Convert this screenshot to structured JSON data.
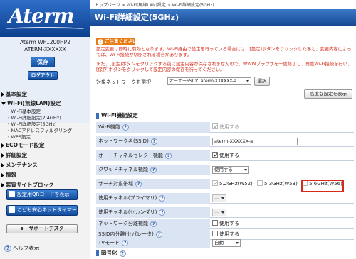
{
  "sidebar": {
    "logo": "Aterm",
    "model_name": "Aterm  WF1200HP2",
    "model_id": "ATERM-XXXXXX",
    "save_label": "保存",
    "logout_label": "ログアウト",
    "nav": {
      "basic": "基本設定",
      "wifi": "Wi-Fi(無線LAN)設定",
      "wifi_sub": [
        "Wi-Fi基本設定",
        "Wi-Fi詳細設定(2.4GHz)",
        "Wi-Fi詳細設定(5GHz)",
        "MACアドレスフィルタリング",
        "WPS設定"
      ],
      "eco": "ECOモード設定",
      "detail": "詳細設定",
      "maintenance": "メンテナンス",
      "info": "情報",
      "block": "悪質サイトブロック"
    },
    "qr_button": "設定用QRコードを表示",
    "kids_button": "こども安心ネットタイマー",
    "support_button": "サポートデスク",
    "help_link": "ヘルプ表示"
  },
  "main": {
    "breadcrumb": "トップページ > Wi-Fi(無線LAN)設定 > Wi-Fi詳細設定(5GHz)",
    "title": "Wi-Fi詳細設定(5GHz)",
    "notice_badge": "ご注意ください",
    "notice1": "設定変更は即時に有効となります。Wi-Fi経由で設定を行っている場合には、[設定]ボタンをクリックしたあと、変更内容によっては、Wi-Fi接続が切断される場合があります。",
    "notice2": "また、[設定]ボタンをクリックする前に設定内容が保存されませんので、WWWブラウザを一度終了し、再度Wi-Fi接続を行い、[保存]ボタンをクリックして設定内容の保存を行ってください。",
    "target_network_label": "対象ネットワークを選択",
    "target_network_value": "オーナーSSID：aterm-XXXXXX-a",
    "select_button": "選択",
    "advanced_button": "高度な設定を表示",
    "section1_title": "Wi-Fi機能設定",
    "section2_title": "暗号化",
    "rows": {
      "wifi_func": {
        "label": "Wi-Fi機能",
        "value": "使用する"
      },
      "ssid": {
        "label": "ネットワーク名(SSID)",
        "value": "aterm-XXXXXX-a"
      },
      "auto_channel": {
        "label": "オートチャネルセレクト機能",
        "value": "使用する"
      },
      "quad": {
        "label": "クワッドチャネル機能",
        "value": "使用する"
      },
      "band": {
        "label": "サーチ対象帯域",
        "options": [
          "5.2GHz(W52)",
          "5.3GHz(W53)",
          "5.6GHz(W56)"
        ]
      },
      "primary": {
        "label": "使用チャネル(プライマリ)",
        "value": "—"
      },
      "secondary": {
        "label": "使用チャネル(セカンダリ)",
        "value": "—"
      },
      "separation": {
        "label": "ネットワーク分離機能",
        "value": "使用する"
      },
      "ssid_sep": {
        "label": "SSID内分離(セパレータ)",
        "value": "使用する"
      },
      "tv_mode": {
        "label": "TVモード",
        "value": "自動"
      }
    }
  },
  "colors": {
    "brand_blue": "#1a4fa0",
    "notice_red": "#d42a1a",
    "notice_orange": "#e87a12",
    "highlight_red": "#d62a1a"
  }
}
